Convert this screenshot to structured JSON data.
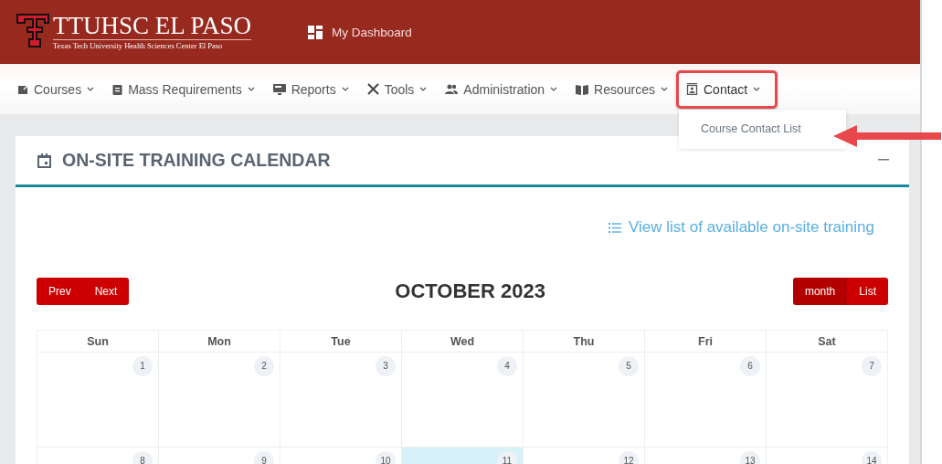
{
  "header": {
    "logo_title": "TTUHSC EL PASO",
    "logo_subtitle": "Texas Tech University Health Sciences Center El Paso",
    "dashboard_link": "My Dashboard"
  },
  "nav": [
    {
      "label": "Courses",
      "expanded": false
    },
    {
      "label": "Mass Requirements",
      "expanded": false
    },
    {
      "label": "Reports",
      "expanded": false
    },
    {
      "label": "Tools",
      "expanded": false
    },
    {
      "label": "Administration",
      "expanded": false
    },
    {
      "label": "Resources",
      "expanded": false
    },
    {
      "label": "Contact",
      "expanded": true,
      "menu": [
        "Course Contact List"
      ]
    }
  ],
  "card": {
    "title": "ON-SITE TRAINING CALENDAR",
    "list_link": "View list of available on-site training"
  },
  "calendar": {
    "month_title": "OCTOBER 2023",
    "nav_buttons": [
      "Prev",
      "Next"
    ],
    "views": [
      {
        "label": "month",
        "selected": true
      },
      {
        "label": "List",
        "selected": false
      }
    ],
    "weekdays": [
      "Sun",
      "Mon",
      "Tue",
      "Wed",
      "Thu",
      "Fri",
      "Sat"
    ],
    "weeks": [
      [
        {
          "day": "1",
          "today": false
        },
        {
          "day": "2",
          "today": false
        },
        {
          "day": "3",
          "today": false
        },
        {
          "day": "4",
          "today": false
        },
        {
          "day": "5",
          "today": false
        },
        {
          "day": "6",
          "today": false
        },
        {
          "day": "7",
          "today": false
        }
      ],
      [
        {
          "day": "8",
          "today": false
        },
        {
          "day": "9",
          "today": false
        },
        {
          "day": "10",
          "today": false
        },
        {
          "day": "11",
          "today": true
        },
        {
          "day": "12",
          "today": false
        },
        {
          "day": "13",
          "today": false
        },
        {
          "day": "14",
          "today": false
        }
      ]
    ]
  }
}
